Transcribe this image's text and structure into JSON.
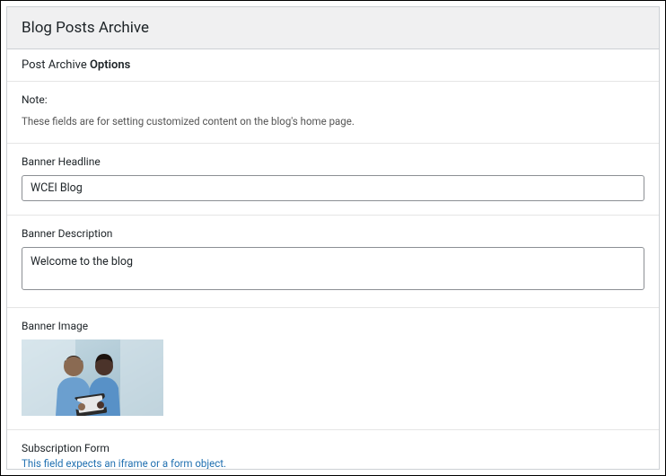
{
  "header": {
    "title": "Blog Posts Archive"
  },
  "section_title": {
    "prefix": "Post Archive ",
    "bold": "Options"
  },
  "note": {
    "label": "Note:",
    "text": "These fields are for setting customized content on the blog's home page."
  },
  "banner_headline": {
    "label": "Banner Headline",
    "value": "WCEI Blog"
  },
  "banner_description": {
    "label": "Banner Description",
    "value": "Welcome to the blog"
  },
  "banner_image": {
    "label": "Banner Image"
  },
  "subscription_form": {
    "label": "Subscription Form",
    "helper": "This field expects an iframe or a form object."
  }
}
